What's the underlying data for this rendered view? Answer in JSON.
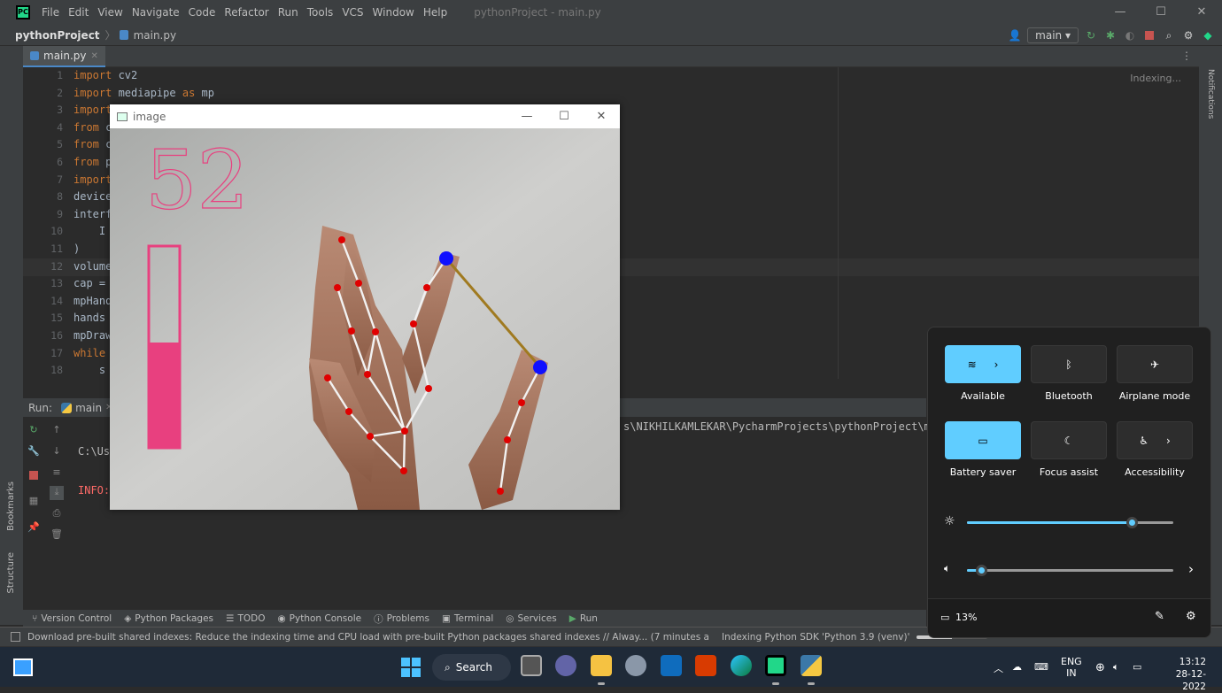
{
  "app": {
    "logo": "PC",
    "menu": [
      "File",
      "Edit",
      "View",
      "Navigate",
      "Code",
      "Refactor",
      "Run",
      "Tools",
      "VCS",
      "Window",
      "Help"
    ],
    "window_title": "pythonProject - main.py",
    "win_controls": {
      "minimize": "—",
      "maximize": "☐",
      "close": "✕"
    }
  },
  "nav": {
    "project": "pythonProject",
    "file": "main.py",
    "branch": "main ▾"
  },
  "editor": {
    "tab_label": "main.py",
    "line_numbers": [
      "1",
      "2",
      "3",
      "4",
      "5",
      "6",
      "7",
      "8",
      "9",
      "10",
      "11",
      "12",
      "13",
      "14",
      "15",
      "16",
      "17",
      "18"
    ],
    "lines": [
      {
        "kw": "import",
        "rest": " cv2"
      },
      {
        "kw": "import",
        "rest": " mediapipe ",
        "kw2": "as",
        "rest2": " mp"
      },
      {
        "kw": "import",
        "rest": ""
      },
      {
        "kw": "from",
        "rest": " c"
      },
      {
        "kw": "from",
        "rest": " c"
      },
      {
        "kw": "from",
        "rest": " p"
      },
      {
        "kw": "import",
        "rest": ""
      },
      {
        "kw": "",
        "rest": "device"
      },
      {
        "kw": "",
        "rest": "interf"
      },
      {
        "kw": "",
        "rest": "    I"
      },
      {
        "kw": "",
        "rest": ")"
      },
      {
        "kw": "",
        "rest": "volume"
      },
      {
        "kw": "",
        "rest": "cap = "
      },
      {
        "kw": "",
        "rest": "mpHand"
      },
      {
        "kw": "",
        "rest": "hands "
      },
      {
        "kw": "",
        "rest": "mpDraw"
      },
      {
        "kw": "while",
        "rest": " "
      },
      {
        "kw": "",
        "rest": "    s"
      }
    ],
    "indexing": "Indexing..."
  },
  "run": {
    "label": "Run:",
    "config": "main",
    "line1": "C:\\Us",
    "line2": "INFO:",
    "path": "s\\NIKHILKAMLEKAR\\PycharmProjects\\pythonProject\\ma"
  },
  "bottom_tabs": [
    "Version Control",
    "Python Packages",
    "TODO",
    "Python Console",
    "Problems",
    "Terminal",
    "Services",
    "Run"
  ],
  "side": {
    "bookmarks": "Bookmarks",
    "structure": "Structure",
    "notifications": "Notifications"
  },
  "status": {
    "message": "Download pre-built shared indexes: Reduce the indexing time and CPU load with pre-built Python packages shared indexes // Alway... (7 minutes a",
    "task": "Indexing Python SDK 'Python 3.9 (venv)'"
  },
  "image_window": {
    "title": "image",
    "volume_text": "52",
    "volume_level": 0.52,
    "colors": {
      "bar": "#e8407f",
      "landmark": "#e00000",
      "tip": "#1010ff",
      "line": "#a07a20"
    }
  },
  "quick_settings": {
    "tiles": [
      {
        "label": "Available",
        "on": true,
        "icon": "wifi-icon"
      },
      {
        "label": "Bluetooth",
        "on": false,
        "icon": "bluetooth-icon"
      },
      {
        "label": "Airplane mode",
        "on": false,
        "icon": "airplane-icon"
      },
      {
        "label": "Battery saver",
        "on": true,
        "icon": "battery-saver-icon"
      },
      {
        "label": "Focus assist",
        "on": false,
        "icon": "moon-icon"
      },
      {
        "label": "Accessibility",
        "on": false,
        "icon": "accessibility-icon"
      }
    ],
    "brightness": 0.8,
    "volume": 0.07,
    "battery": "13%",
    "accent": "#60cdff"
  },
  "taskbar": {
    "search": "Search",
    "lang1": "ENG",
    "lang2": "IN",
    "time": "13:12",
    "date": "28-12-2022"
  }
}
